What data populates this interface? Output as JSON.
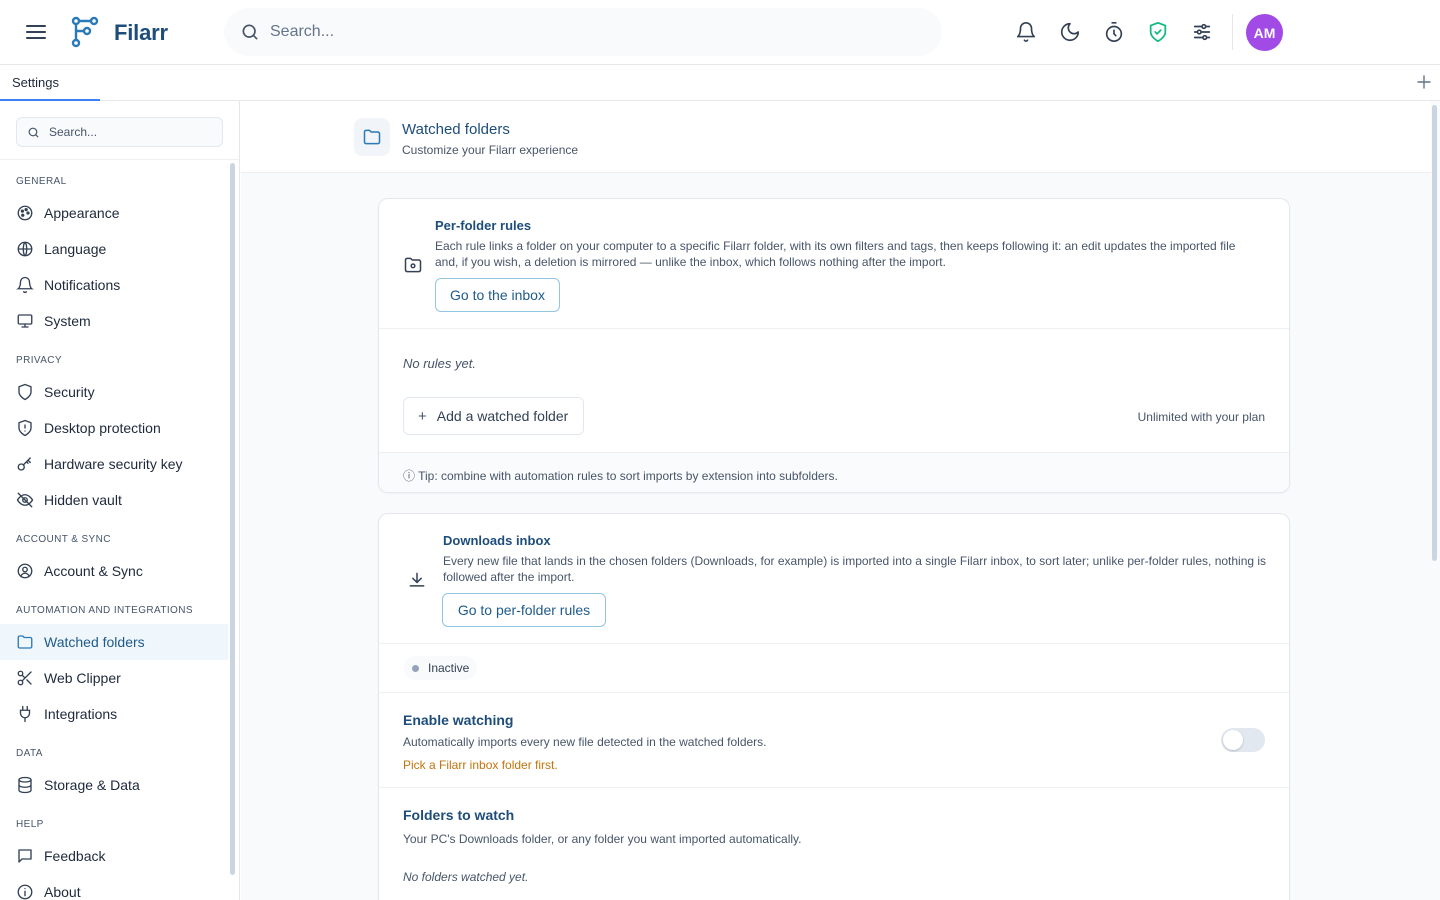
{
  "app": {
    "name": "Filarr",
    "search_placeholder": "Search...",
    "avatar_initials": "AM",
    "colors": {
      "brand": "#1e4d7b",
      "accent": "#3b82f6",
      "avatar": "#a24ae6",
      "shield": "#10b981",
      "warning": "#c2740c"
    }
  },
  "topbar": {
    "icons": [
      "bell-icon",
      "moon-icon",
      "timer-icon",
      "shield-check-icon",
      "sliders-icon"
    ]
  },
  "tabs": [
    {
      "label": "Settings"
    }
  ],
  "sidebar": {
    "search_placeholder": "Search...",
    "sections": [
      {
        "title": "GENERAL",
        "items": [
          {
            "label": "Appearance",
            "icon": "palette-icon"
          },
          {
            "label": "Language",
            "icon": "globe-icon"
          },
          {
            "label": "Notifications",
            "icon": "bell-icon"
          },
          {
            "label": "System",
            "icon": "monitor-icon"
          }
        ]
      },
      {
        "title": "PRIVACY",
        "items": [
          {
            "label": "Security",
            "icon": "shield-icon"
          },
          {
            "label": "Desktop protection",
            "icon": "shield-alert-icon"
          },
          {
            "label": "Hardware security key",
            "icon": "key-icon"
          },
          {
            "label": "Hidden vault",
            "icon": "eye-off-icon"
          }
        ]
      },
      {
        "title": "ACCOUNT & SYNC",
        "items": [
          {
            "label": "Account & Sync",
            "icon": "user-circle-icon"
          }
        ]
      },
      {
        "title": "AUTOMATION AND INTEGRATIONS",
        "items": [
          {
            "label": "Watched folders",
            "icon": "folder-icon",
            "active": true
          },
          {
            "label": "Web Clipper",
            "icon": "scissors-icon"
          },
          {
            "label": "Integrations",
            "icon": "plug-icon"
          }
        ]
      },
      {
        "title": "DATA",
        "items": [
          {
            "label": "Storage & Data",
            "icon": "database-icon"
          }
        ]
      },
      {
        "title": "HELP",
        "items": [
          {
            "label": "Feedback",
            "icon": "message-icon"
          },
          {
            "label": "About",
            "icon": "info-icon"
          }
        ]
      }
    ]
  },
  "page": {
    "title": "Watched folders",
    "subtitle": "Customize your Filarr experience"
  },
  "per_folder": {
    "title": "Per-folder rules",
    "desc_line1": "Each rule links a folder on your computer to a specific Filarr folder, with its own filters and tags, then keeps following it: an edit updates the imported file",
    "desc_line2": "and, if you wish, a deletion is mirrored — unlike the inbox, which follows nothing after the import.",
    "button": "Go to the inbox",
    "empty": "No rules yet.",
    "add_button": "Add a watched folder",
    "plan_note": "Unlimited with your plan",
    "tip": "ⓘ Tip: combine with automation rules to sort imports by extension into subfolders."
  },
  "downloads": {
    "title": "Downloads inbox",
    "desc_line1": "Every new file that lands in the chosen folders (Downloads, for example) is imported into a single Filarr inbox, to sort later; unlike per-folder rules, nothing is",
    "desc_line2": "followed after the import.",
    "button": "Go to per-folder rules",
    "status": "Inactive",
    "enable_title": "Enable watching",
    "enable_desc": "Automatically imports every new file detected in the watched folders.",
    "enable_warning": "Pick a Filarr inbox folder first.",
    "enable_on": false,
    "folders_title": "Folders to watch",
    "folders_desc": "Your PC's Downloads folder, or any folder you want imported automatically.",
    "folders_empty": "No folders watched yet."
  }
}
